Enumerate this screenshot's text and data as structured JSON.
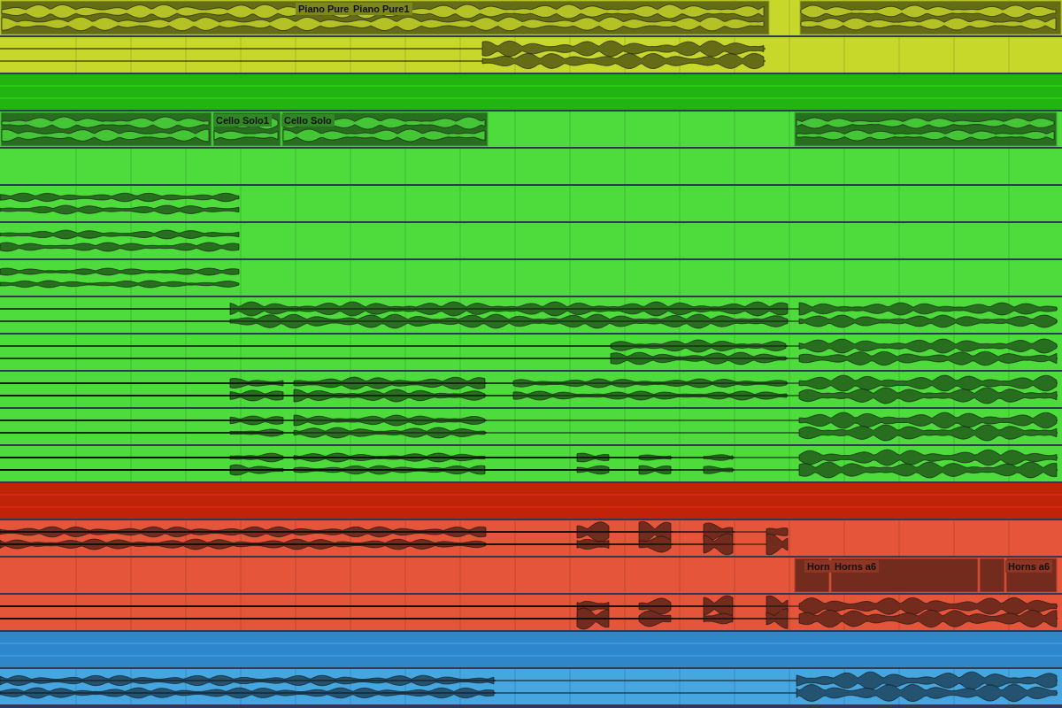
{
  "tracks": [
    {
      "kind": "clip",
      "color": "#c8d82a",
      "clips": [
        {
          "label": "Piano Pure"
        },
        {
          "label": "Piano Pure1"
        }
      ]
    },
    {
      "kind": "audio",
      "color": "#c8d82a"
    },
    {
      "kind": "folder",
      "color": "#22b511"
    },
    {
      "kind": "clip",
      "color": "#4ddc3c",
      "clips": [
        {
          "label": "Cello Solo1"
        },
        {
          "label": "Cello Solo"
        }
      ]
    },
    {
      "kind": "audio",
      "color": "#4ddc3c"
    },
    {
      "kind": "audio",
      "color": "#4ddc3c"
    },
    {
      "kind": "audio",
      "color": "#4ddc3c"
    },
    {
      "kind": "audio",
      "color": "#4ddc3c"
    },
    {
      "kind": "audio",
      "color": "#4ddc3c"
    },
    {
      "kind": "audio",
      "color": "#4ddc3c"
    },
    {
      "kind": "audio",
      "color": "#4ddc3c"
    },
    {
      "kind": "audio",
      "color": "#4ddc3c"
    },
    {
      "kind": "audio",
      "color": "#4ddc3c"
    },
    {
      "kind": "folder",
      "color": "#c0230a"
    },
    {
      "kind": "audio",
      "color": "#e5553a"
    },
    {
      "kind": "clip",
      "color": "#e5553a",
      "clips": [
        {
          "label": "Horn"
        },
        {
          "label": "Horns a6"
        },
        {
          "label": "Horns a6"
        }
      ]
    },
    {
      "kind": "audio",
      "color": "#e5553a"
    },
    {
      "kind": "folder",
      "color": "#2f87c9"
    },
    {
      "kind": "audio",
      "color": "#45a6e0"
    }
  ]
}
